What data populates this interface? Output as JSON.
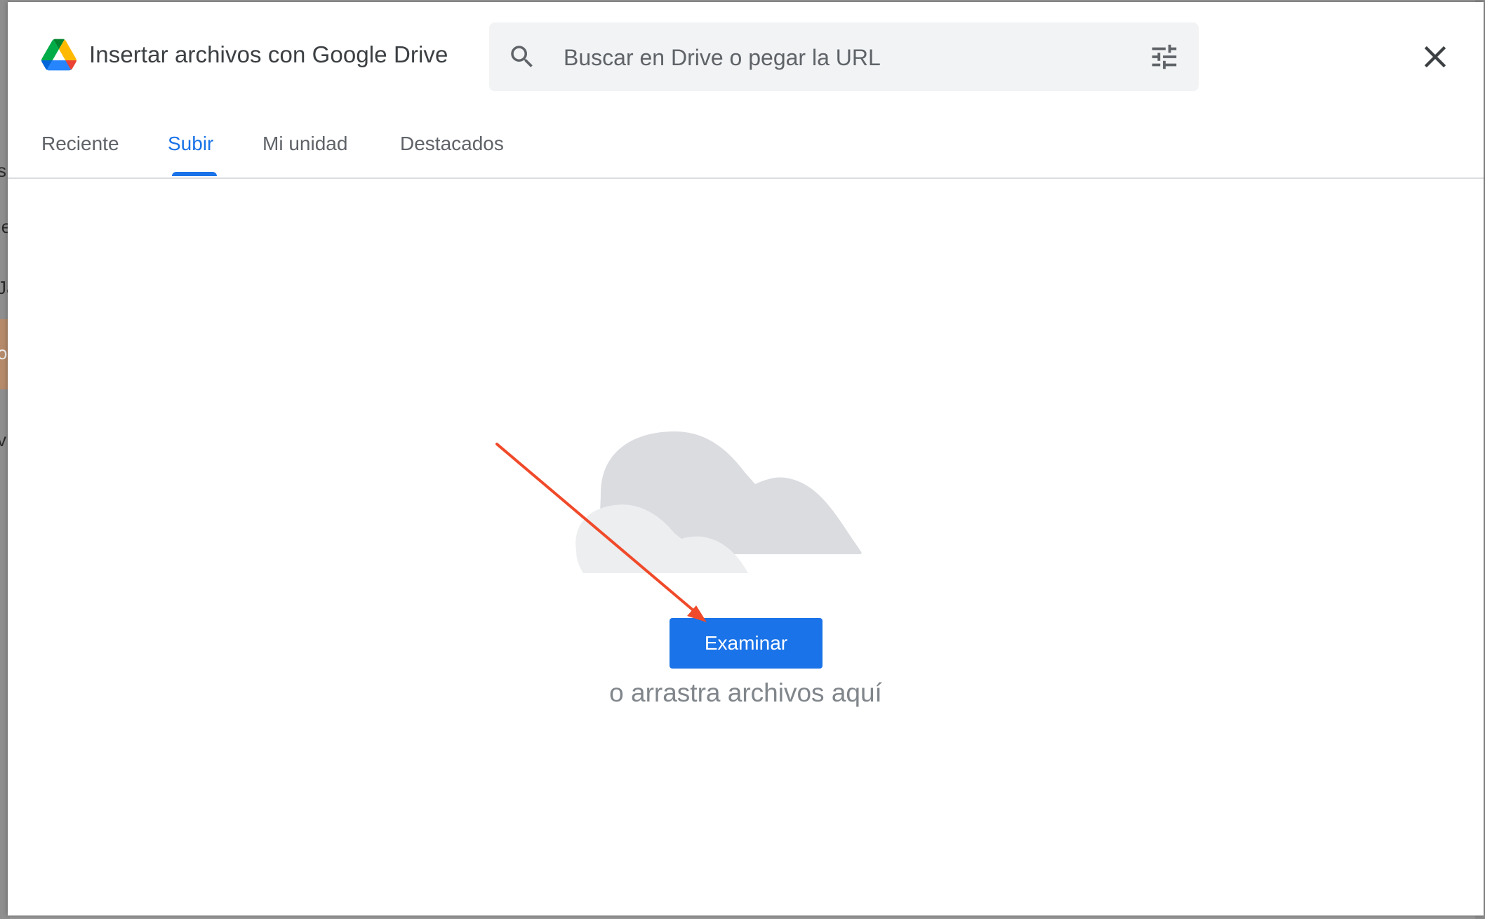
{
  "background": {
    "letters": [
      "s",
      "ie",
      "Ja",
      "o",
      "v"
    ]
  },
  "dialog": {
    "title": "Insertar archivos con Google Drive",
    "search": {
      "placeholder": "Buscar en Drive o pegar la URL",
      "value": ""
    },
    "icons": {
      "logo": "google-drive-logo",
      "search": "search-icon",
      "filter": "tune-icon",
      "close": "close-icon"
    },
    "tabs": [
      {
        "label": "Reciente",
        "active": false
      },
      {
        "label": "Subir",
        "active": true
      },
      {
        "label": "Mi unidad",
        "active": false
      },
      {
        "label": "Destacados",
        "active": false
      }
    ],
    "upload": {
      "browse_label": "Examinar",
      "drag_text": "o arrastra archivos aquí"
    },
    "colors": {
      "accent": "#1a73e8",
      "annotation_arrow": "#f04a2a",
      "cloud_back": "#dadce0",
      "cloud_front": "#eceef0"
    }
  }
}
